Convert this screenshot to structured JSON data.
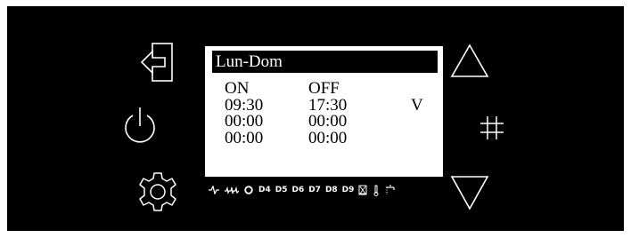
{
  "screen": {
    "title": "Lun-Dom",
    "headers": {
      "on": "ON",
      "off": "OFF"
    },
    "rows": [
      {
        "on": "09:30",
        "off": "17:30",
        "flag": "V"
      },
      {
        "on": "00:00",
        "off": "00:00",
        "flag": ""
      },
      {
        "on": "00:00",
        "off": "00:00",
        "flag": ""
      }
    ]
  },
  "status_bar": {
    "indicators": [
      "D4",
      "D5",
      "D6",
      "D7",
      "D8",
      "D9"
    ],
    "icons": [
      "pulse-icon",
      "double-pulse-icon",
      "circle-icon",
      "hourglass-icon",
      "thermometer-icon",
      "faucet-icon"
    ]
  },
  "buttons": {
    "left": [
      "exit-icon",
      "power-icon",
      "gear-icon"
    ],
    "right": [
      "up-triangle-icon",
      "hash-icon",
      "down-triangle-icon"
    ]
  },
  "colors": {
    "panel": "#000000",
    "screen": "#ffffff",
    "icon_stroke": "#ffffff"
  }
}
